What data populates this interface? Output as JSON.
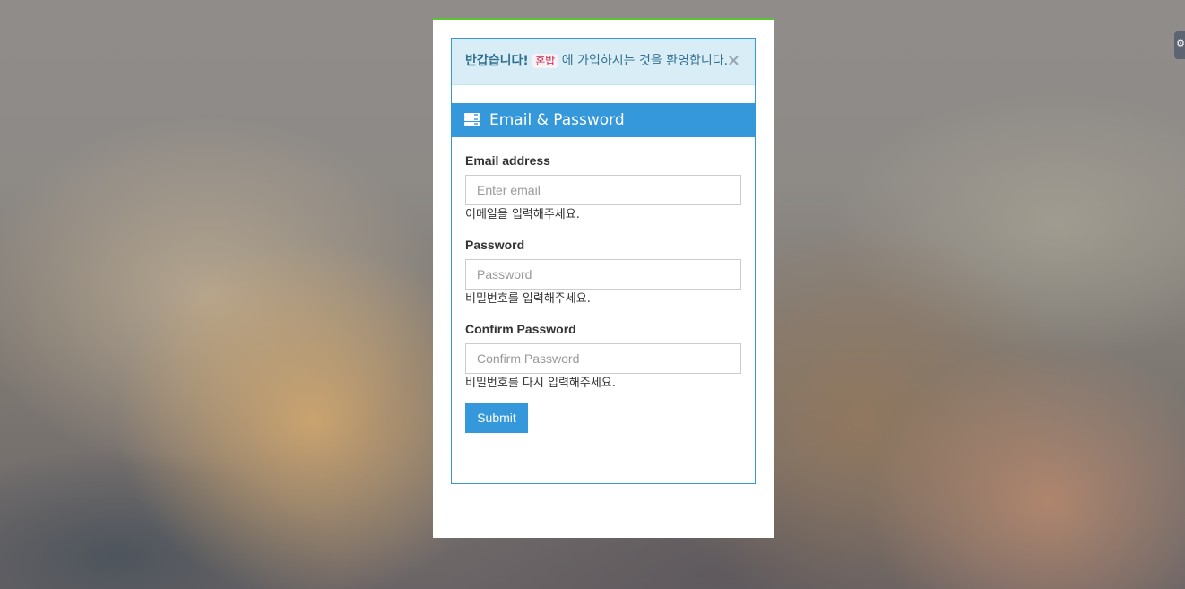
{
  "alert": {
    "strong": "반갑습니다!",
    "app_name": "혼밥",
    "message": " 에 가입하시는 것을 환영합니다.",
    "close": "×"
  },
  "panel": {
    "icon": "server-icon",
    "title": "Email & Password"
  },
  "form": {
    "email": {
      "label": "Email address",
      "placeholder": "Enter email",
      "help": "이메일을 입력해주세요."
    },
    "password": {
      "label": "Password",
      "placeholder": "Password",
      "help": "비밀번호를 입력해주세요."
    },
    "confirm": {
      "label": "Confirm Password",
      "placeholder": "Confirm Password",
      "help": "비밀번호를 다시 입력해주세요."
    },
    "submit_label": "Submit"
  },
  "colors": {
    "accent": "#3498db",
    "top_border": "#5cc433",
    "alert_bg": "#d9edf7",
    "alert_text": "#31708f"
  }
}
